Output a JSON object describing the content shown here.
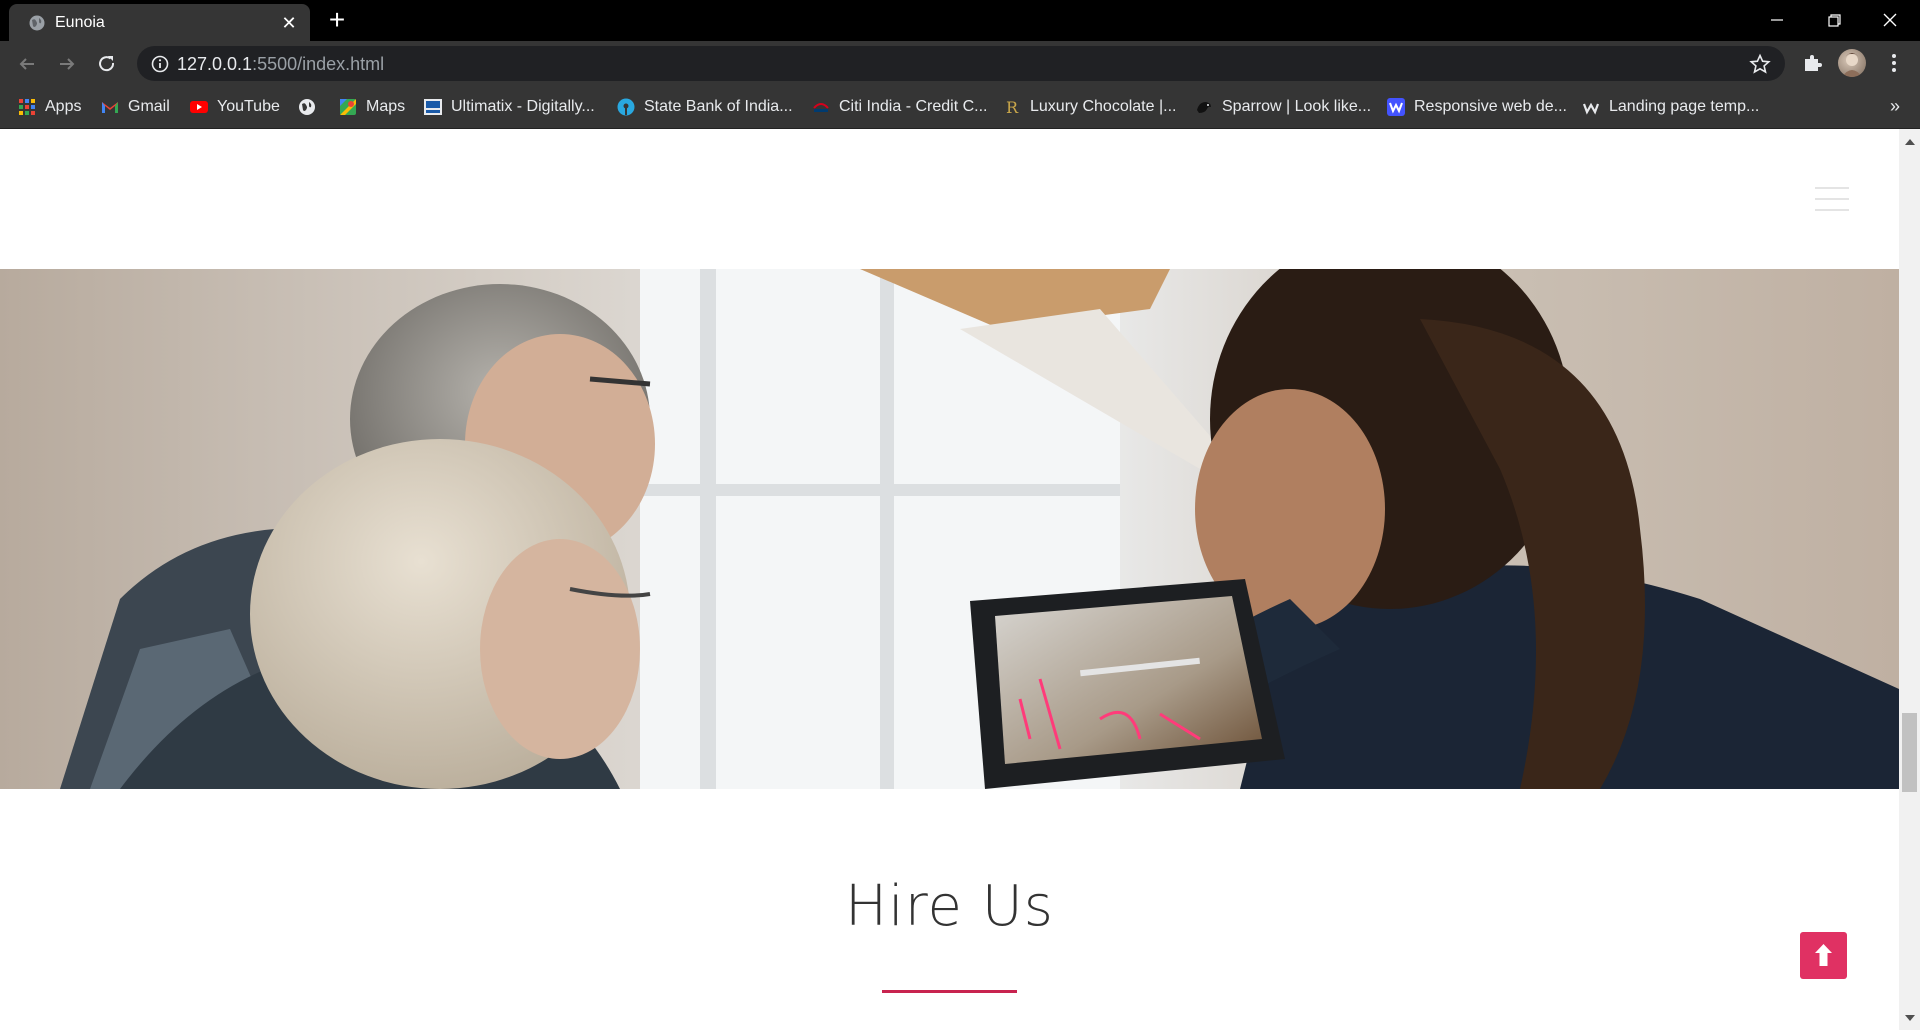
{
  "browser": {
    "tab": {
      "title": "Eunoia",
      "favicon": "globe-icon",
      "close": "✕"
    },
    "newtab": "+",
    "window_controls": [
      "minimize-icon",
      "restore-icon",
      "close-icon"
    ],
    "address": {
      "host": "127.0.0.1",
      "path": ":5500/index.html"
    },
    "bookmarks": [
      {
        "label": "Apps",
        "icon": "apps-grid-icon"
      },
      {
        "label": "Gmail",
        "icon": "gmail-icon"
      },
      {
        "label": "YouTube",
        "icon": "youtube-icon"
      },
      {
        "label": "",
        "icon": "globe-icon"
      },
      {
        "label": "Maps",
        "icon": "maps-icon"
      },
      {
        "label": "Ultimatix - Digitally...",
        "icon": "tata-icon"
      },
      {
        "label": "State Bank of India...",
        "icon": "sbi-icon"
      },
      {
        "label": "Citi India - Credit C...",
        "icon": "citi-icon"
      },
      {
        "label": "Luxury Chocolate |...",
        "icon": "r-letter-icon"
      },
      {
        "label": "Sparrow | Look like...",
        "icon": "sparrow-icon"
      },
      {
        "label": "Responsive web de...",
        "icon": "w-icon"
      },
      {
        "label": "Landing page temp...",
        "icon": "w-small-icon"
      }
    ],
    "bookmarks_more": "»"
  },
  "page": {
    "hero_image": "people-with-tablet-image",
    "section_title": "Hire Us",
    "accent_color": "#c8234f",
    "to_top_color": "#e03163"
  }
}
